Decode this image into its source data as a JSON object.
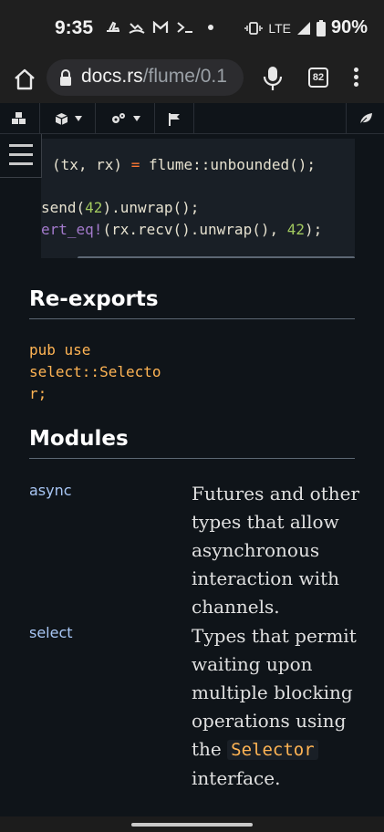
{
  "status_bar": {
    "time": "9:35",
    "network": "LTE",
    "battery": "90%"
  },
  "browser": {
    "url_host": "docs.rs",
    "url_path": "/flume/0.1",
    "tab_count": "82"
  },
  "code_example": {
    "lines": [
      {
        "text_pre": "(tx, rx) ",
        "op": "=",
        "text_post": " flume::unbounded();"
      },
      {
        "a": "send(",
        "n": "42",
        "b": ").unwrap();"
      },
      {
        "m": "ert_eq!",
        "a": "(rx.recv().unwrap(), ",
        "n": "42",
        "b": ");"
      }
    ]
  },
  "reexports": {
    "heading": "Re-exports",
    "line1_kw": "pub use",
    "line2": "select::Selecto",
    "line3": "r;"
  },
  "modules": {
    "heading": "Modules",
    "items": [
      {
        "name": "async",
        "description": "Futures and other types that allow asynchronous interaction with channels."
      },
      {
        "name": "select",
        "description_pre": "Types that permit waiting upon multiple blocking operations using the",
        "code": "Selector",
        "description_post": "interface."
      }
    ]
  },
  "colors": {
    "background": "#0f1419",
    "keyword": "#ff7733",
    "number": "#a2c95f",
    "macro": "#a37acc",
    "reexport": "#ffb454",
    "link": "#a9c7f5"
  }
}
